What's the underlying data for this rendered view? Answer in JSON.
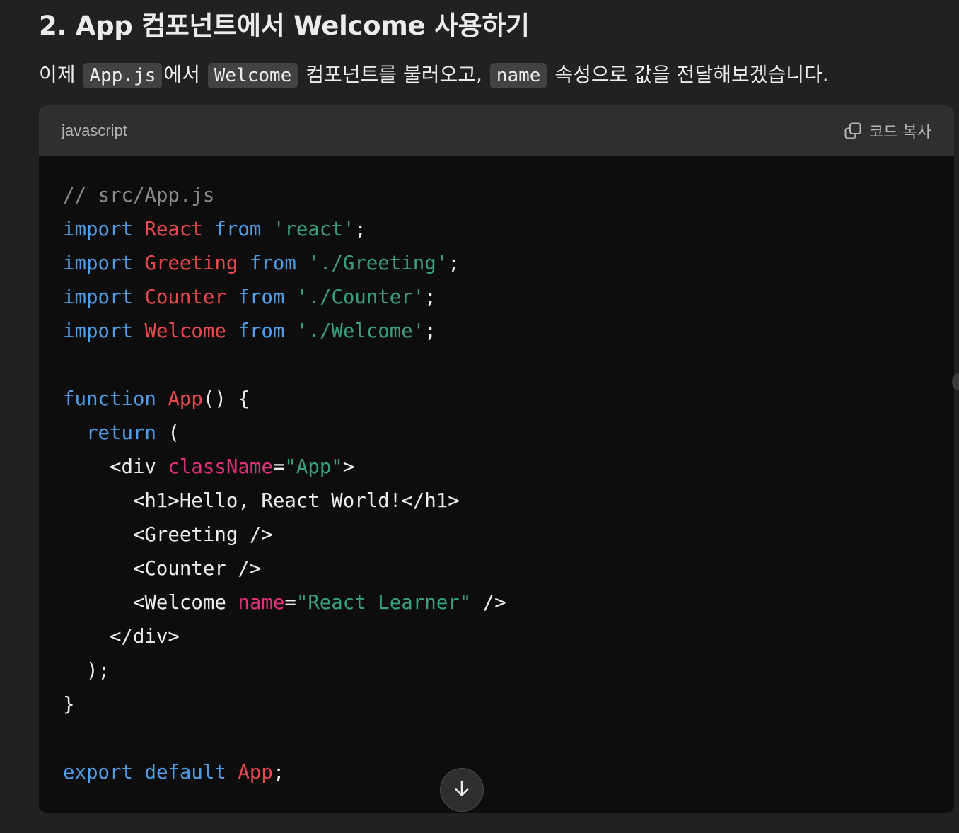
{
  "heading": {
    "text": "2. App 컴포넌트에서 Welcome 사용하기"
  },
  "paragraph": {
    "part1": "이제 ",
    "code1": "App.js",
    "part2": "에서 ",
    "code2": "Welcome",
    "part3": " 컴포넌트를 불러오고, ",
    "code3": "name",
    "part4": " 속성으로 값을 전달해보겠습니다."
  },
  "code_block": {
    "language": "javascript",
    "copy_label": "코드 복사",
    "copy_icon": "copy-icon",
    "lines": [
      [
        {
          "t": "// src/App.js",
          "c": "comment"
        }
      ],
      [
        {
          "t": "import",
          "c": "keyword"
        },
        {
          "t": " ",
          "c": "plain"
        },
        {
          "t": "React",
          "c": "name"
        },
        {
          "t": " ",
          "c": "plain"
        },
        {
          "t": "from",
          "c": "keyword"
        },
        {
          "t": " ",
          "c": "plain"
        },
        {
          "t": "'react'",
          "c": "string"
        },
        {
          "t": ";",
          "c": "plain"
        }
      ],
      [
        {
          "t": "import",
          "c": "keyword"
        },
        {
          "t": " ",
          "c": "plain"
        },
        {
          "t": "Greeting",
          "c": "name"
        },
        {
          "t": " ",
          "c": "plain"
        },
        {
          "t": "from",
          "c": "keyword"
        },
        {
          "t": " ",
          "c": "plain"
        },
        {
          "t": "'./Greeting'",
          "c": "string"
        },
        {
          "t": ";",
          "c": "plain"
        }
      ],
      [
        {
          "t": "import",
          "c": "keyword"
        },
        {
          "t": " ",
          "c": "plain"
        },
        {
          "t": "Counter",
          "c": "name"
        },
        {
          "t": " ",
          "c": "plain"
        },
        {
          "t": "from",
          "c": "keyword"
        },
        {
          "t": " ",
          "c": "plain"
        },
        {
          "t": "'./Counter'",
          "c": "string"
        },
        {
          "t": ";",
          "c": "plain"
        }
      ],
      [
        {
          "t": "import",
          "c": "keyword"
        },
        {
          "t": " ",
          "c": "plain"
        },
        {
          "t": "Welcome",
          "c": "name"
        },
        {
          "t": " ",
          "c": "plain"
        },
        {
          "t": "from",
          "c": "keyword"
        },
        {
          "t": " ",
          "c": "plain"
        },
        {
          "t": "'./Welcome'",
          "c": "string"
        },
        {
          "t": ";",
          "c": "plain"
        }
      ],
      [],
      [
        {
          "t": "function",
          "c": "keyword"
        },
        {
          "t": " ",
          "c": "plain"
        },
        {
          "t": "App",
          "c": "name"
        },
        {
          "t": "() {",
          "c": "plain"
        }
      ],
      [
        {
          "t": "  ",
          "c": "plain"
        },
        {
          "t": "return",
          "c": "keyword"
        },
        {
          "t": " (",
          "c": "plain"
        }
      ],
      [
        {
          "t": "    <div ",
          "c": "plain"
        },
        {
          "t": "className",
          "c": "attr"
        },
        {
          "t": "=",
          "c": "plain"
        },
        {
          "t": "\"App\"",
          "c": "string"
        },
        {
          "t": ">",
          "c": "plain"
        }
      ],
      [
        {
          "t": "      <h1>Hello, React World!</h1>",
          "c": "plain"
        }
      ],
      [
        {
          "t": "      <Greeting />",
          "c": "plain"
        }
      ],
      [
        {
          "t": "      <Counter />",
          "c": "plain"
        }
      ],
      [
        {
          "t": "      <Welcome ",
          "c": "plain"
        },
        {
          "t": "name",
          "c": "attr"
        },
        {
          "t": "=",
          "c": "plain"
        },
        {
          "t": "\"React Learner\"",
          "c": "string"
        },
        {
          "t": " />",
          "c": "plain"
        }
      ],
      [
        {
          "t": "    </div>",
          "c": "plain"
        }
      ],
      [
        {
          "t": "  );",
          "c": "plain"
        }
      ],
      [
        {
          "t": "}",
          "c": "plain"
        }
      ],
      [],
      [
        {
          "t": "export",
          "c": "keyword"
        },
        {
          "t": " ",
          "c": "plain"
        },
        {
          "t": "default",
          "c": "keyword"
        },
        {
          "t": " ",
          "c": "plain"
        },
        {
          "t": "App",
          "c": "name"
        },
        {
          "t": ";",
          "c": "plain"
        }
      ]
    ]
  },
  "scroll_button": {
    "icon": "arrow-down-icon"
  },
  "colors": {
    "background": "#212121",
    "code_background": "#0d0d0d",
    "code_header": "#2f2f2f",
    "inline_code_background": "#424242",
    "keyword": "#4f9ee5",
    "name": "#e5484d",
    "string": "#3a9e78",
    "attribute": "#df3079",
    "comment": "#8b8b8b"
  }
}
